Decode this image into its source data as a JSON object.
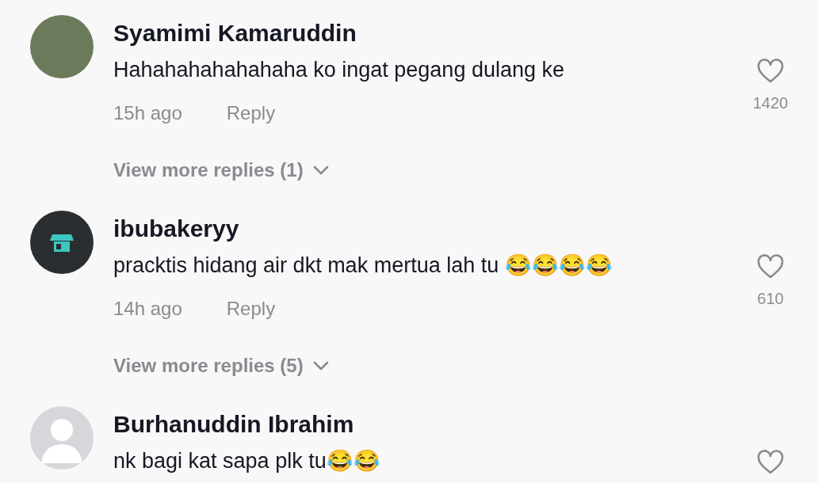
{
  "comments": [
    {
      "avatar": {
        "kind": "photo"
      },
      "name": "Syamimi Kamaruddin",
      "text": "Hahahahahahahaha ko ingat pegang dulang ke",
      "time": "15h ago",
      "reply": "Reply",
      "likes": "1420",
      "view_more": "View more replies (1)"
    },
    {
      "avatar": {
        "kind": "logo"
      },
      "name": "ibubakeryy",
      "text": "pracktis hidang air dkt mak mertua lah tu 😂😂😂😂",
      "time": "14h ago",
      "reply": "Reply",
      "likes": "610",
      "view_more": "View more replies (5)"
    },
    {
      "avatar": {
        "kind": "silhouette"
      },
      "name": "Burhanuddin Ibrahim",
      "text": "nk bagi kat sapa plk tu😂😂"
    }
  ]
}
